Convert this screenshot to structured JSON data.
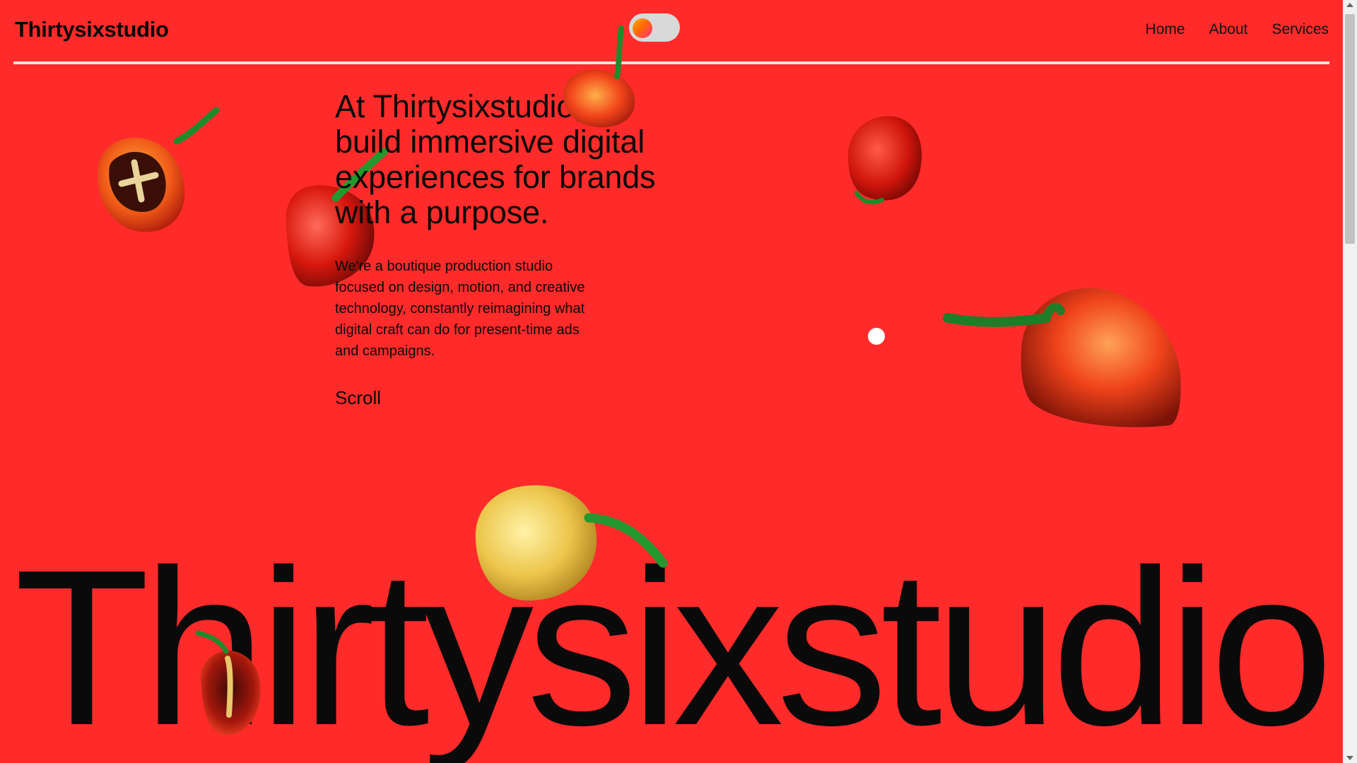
{
  "header": {
    "logo": "Thirtysixstudio",
    "theme_toggle": {
      "state": "on"
    },
    "nav": [
      "Home",
      "About",
      "Services"
    ]
  },
  "hero": {
    "title": "At Thirtysixstudio, we build immersive digital experiences for brands with a purpose.",
    "body": "We're a boutique production studio focused on design, motion, and creative technology, constantly reimagining what digital craft can do for present-time ads and campaigns.",
    "scroll_label": "Scroll"
  },
  "big_wordmark": "Thirtysixstudio",
  "icons": {
    "peppers": [
      "pepper-icon"
    ],
    "cursor": "cursor-dot-icon"
  },
  "colors": {
    "background": "#ff2b2b",
    "text": "#0a0a0a",
    "rule": "#f1dede",
    "toggle_track": "#d9d9d9",
    "pepper_red": "#e8251a",
    "pepper_orange": "#ff7a1a",
    "pepper_yellow": "#f2d56b",
    "stem_green": "#1f8a2a"
  }
}
